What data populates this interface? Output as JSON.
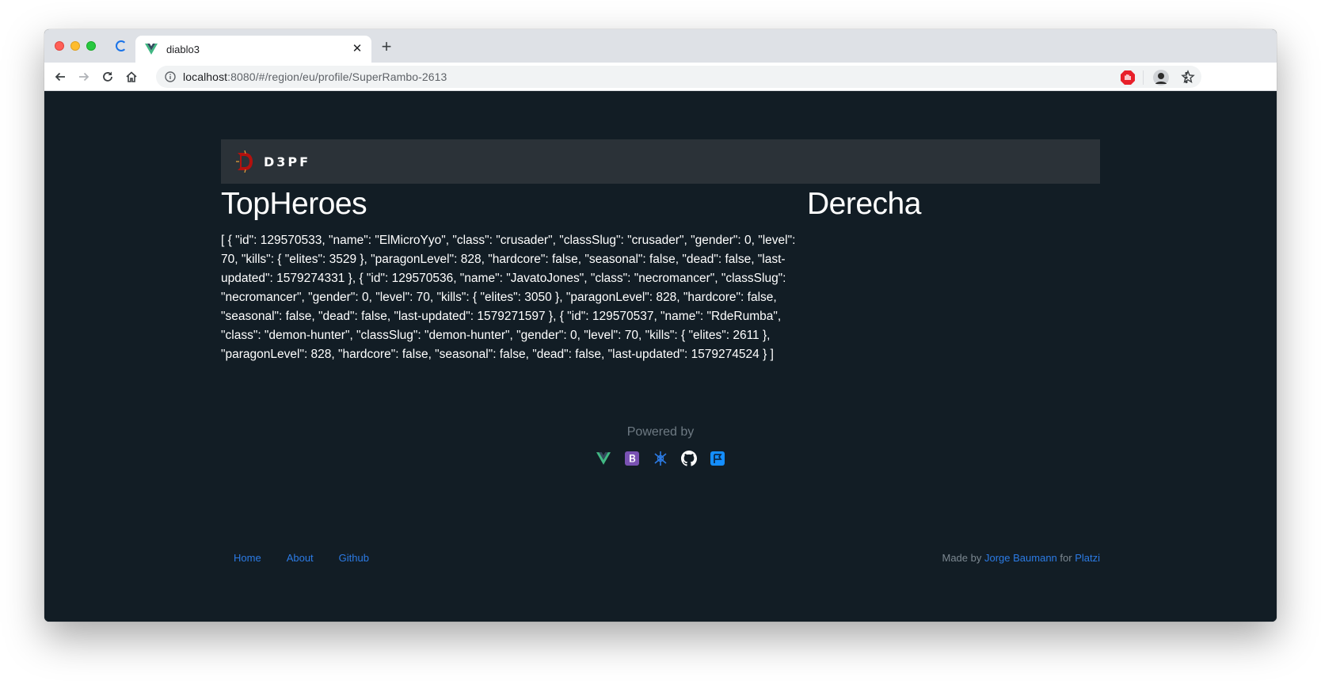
{
  "browser": {
    "tab_title": "diablo3",
    "url_host": "localhost",
    "url_path": ":8080/#/region/eu/profile/SuperRambo-2613",
    "new_tab_symbol": "+",
    "close_symbol": "✕"
  },
  "navbar": {
    "brand": "D3PF"
  },
  "main": {
    "left_heading": "TopHeroes",
    "right_heading": "Derecha",
    "heroes_json": "[ { \"id\": 129570533, \"name\": \"ElMicroYyo\", \"class\": \"crusader\", \"classSlug\": \"crusader\", \"gender\": 0, \"level\": 70, \"kills\": { \"elites\": 3529 }, \"paragonLevel\": 828, \"hardcore\": false, \"seasonal\": false, \"dead\": false, \"last-updated\": 1579274331 }, { \"id\": 129570536, \"name\": \"JavatoJones\", \"class\": \"necromancer\", \"classSlug\": \"necromancer\", \"gender\": 0, \"level\": 70, \"kills\": { \"elites\": 3050 }, \"paragonLevel\": 828, \"hardcore\": false, \"seasonal\": false, \"dead\": false, \"last-updated\": 1579271597 }, { \"id\": 129570537, \"name\": \"RdeRumba\", \"class\": \"demon-hunter\", \"classSlug\": \"demon-hunter\", \"gender\": 0, \"level\": 70, \"kills\": { \"elites\": 2611 }, \"paragonLevel\": 828, \"hardcore\": false, \"seasonal\": false, \"dead\": false, \"last-updated\": 1579274524 } ]"
  },
  "powered": {
    "label": "Powered by",
    "icons": [
      "vue-icon",
      "bootstrap-icon",
      "axios-icon",
      "github-icon",
      "blizzard-icon"
    ]
  },
  "footer": {
    "links": [
      "Home",
      "About",
      "Github"
    ],
    "made_by": "Made by",
    "author": "Jorge Baumann",
    "for": "for",
    "org": "Platzi"
  },
  "colors": {
    "page_bg": "#121d25",
    "navbar_bg": "#2b3238",
    "link": "#2c7be5",
    "vue_green": "#41b883",
    "bootstrap_purple": "#7952b3"
  }
}
